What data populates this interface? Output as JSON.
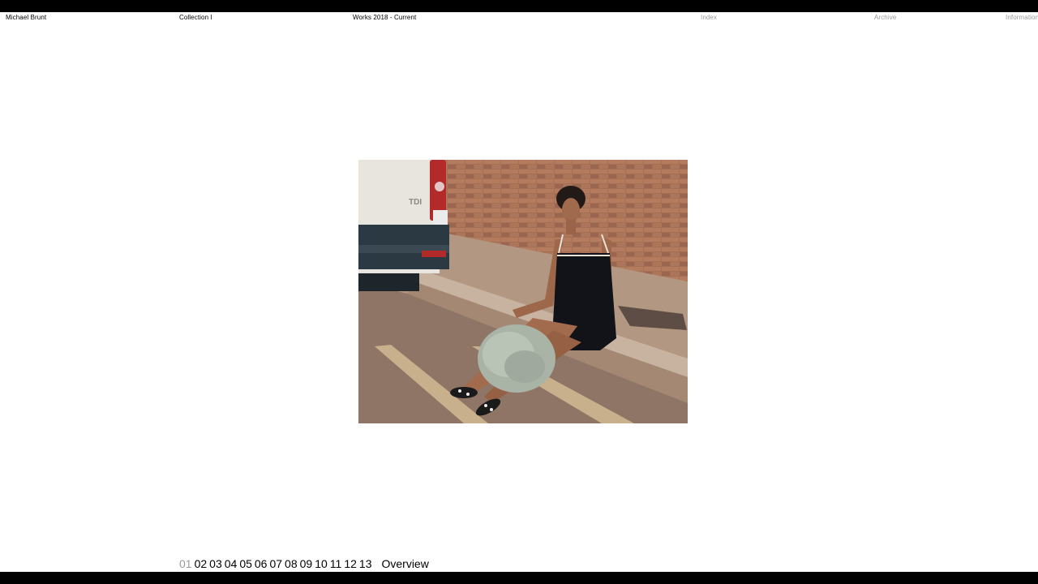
{
  "header": {
    "name": "Michael Brunt",
    "collection": "Collection I",
    "works": "Works 2018 - Current",
    "nav": {
      "index": "Index",
      "archive": "Archive",
      "information": "Information"
    }
  },
  "pager": {
    "pages": [
      "01",
      "02",
      "03",
      "04",
      "05",
      "06",
      "07",
      "08",
      "09",
      "10",
      "11",
      "12",
      "13"
    ],
    "current": "01",
    "overview": "Overview"
  },
  "photo": {
    "van_badge": "TDI"
  }
}
